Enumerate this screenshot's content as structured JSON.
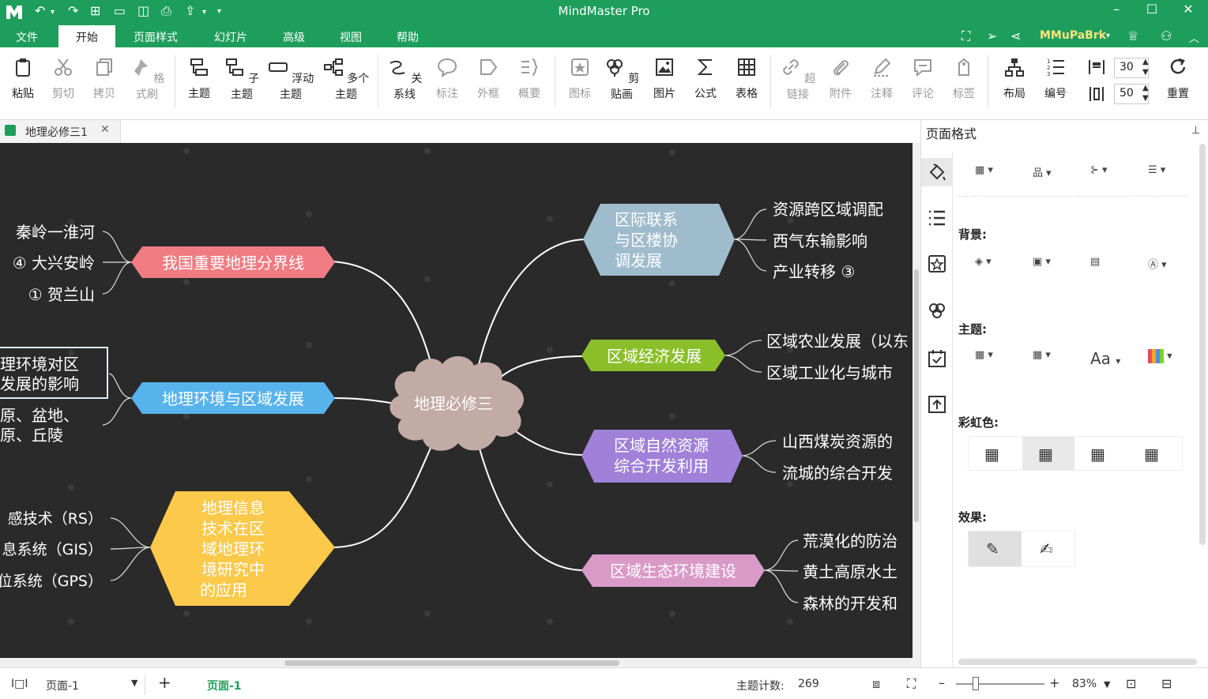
{
  "app": {
    "title": "MindMaster Pro",
    "user": "MMuPaBrk"
  },
  "menu": [
    "文件",
    "开始",
    "页面样式",
    "幻灯片",
    "高级",
    "视图",
    "帮助"
  ],
  "menu_active": "开始",
  "ribbon": {
    "paste": "粘贴",
    "cut": "剪切",
    "copy": "拷贝",
    "format_painter": "格式刷",
    "topic": "主题",
    "subtopic": "子主题",
    "floating": "浮动主题",
    "multi": "多个主题",
    "relation": "关系线",
    "callout": "标注",
    "boundary": "外框",
    "summary": "概要",
    "icon": "图标",
    "clipart": "剪贴画",
    "image": "图片",
    "formula": "公式",
    "table": "表格",
    "hyperlink": "超链接",
    "attachment": "附件",
    "note": "注释",
    "comment": "评论",
    "tag": "标签",
    "layout": "布局",
    "numbering": "编号",
    "spacing_h": "30",
    "spacing_v": "50",
    "reset": "重置"
  },
  "document_tab": "地理必修三1",
  "mindmap": {
    "center": "地理必修三",
    "left": [
      {
        "label": "我国重要地理分界线",
        "color": "#f07b82",
        "children": [
          "秦岭一淮河",
          "④ 大兴安岭",
          "① 贺兰山"
        ]
      },
      {
        "label": "地理环境与区域发展",
        "color": "#58b3ec",
        "children": [
          "理环境对区",
          "发展的影响",
          "原、盆地、",
          "原、丘陵"
        ]
      },
      {
        "label_lines": [
          "地理信息",
          "技术在区",
          "域地理环",
          "境研究中",
          "的应用"
        ],
        "color": "#fdc94a",
        "children": [
          "感技术（RS）",
          "息系统（GIS）",
          "位系统（GPS）"
        ]
      }
    ],
    "right": [
      {
        "label_lines": [
          "区际联系",
          "与区楼协",
          "调发展"
        ],
        "color": "#9fbccc",
        "children": [
          "资源跨区域调配",
          "西气东输影响",
          "产业转移 ③"
        ]
      },
      {
        "label": "区域经济发展",
        "color": "#8bbf2a",
        "children": [
          "区域农业发展（以东",
          "区域工业化与城市"
        ]
      },
      {
        "label_lines": [
          "区域自然资源",
          "综合开发利用"
        ],
        "color": "#a080d8",
        "children": [
          "山西煤炭资源的",
          "流城的综合开发"
        ]
      },
      {
        "label": "区域生态环境建设",
        "color": "#d99ac8",
        "children": [
          "荒漠化的防治",
          "黄土高原水土",
          "森林的开发和"
        ]
      }
    ]
  },
  "panel": {
    "title": "页面格式",
    "background": "背景:",
    "theme": "主题:",
    "theme_font": "Aa",
    "rainbow": "彩虹色:",
    "effect": "效果:"
  },
  "status": {
    "page_name": "页面-1",
    "page_tab": "页面-1",
    "topic_count_label": "主题计数:",
    "topic_count": "269",
    "zoom": "83%"
  }
}
